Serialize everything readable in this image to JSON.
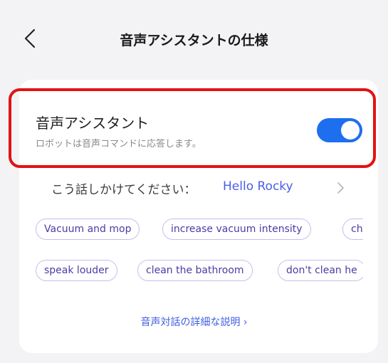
{
  "header": {
    "title": "音声アシスタントの仕様"
  },
  "voice_assistant": {
    "title": "音声アシスタント",
    "subtitle": "ロボットは音声コマンドに応答します。",
    "enabled": true
  },
  "wake_word": {
    "label": "こう話しかけてください：",
    "value": "Hello Rocky"
  },
  "commands": {
    "row1": [
      "Vacuum and mop",
      "increase vacuum intensity",
      "ch"
    ],
    "row2": [
      "speak louder",
      "clean the bathroom",
      "don't clean he"
    ]
  },
  "details_link": "音声対話の詳細な説明 ›",
  "colors": {
    "accent": "#1e6ef0",
    "highlight": "#e31212",
    "chip_border": "#c8bdee",
    "chip_text": "#4d3aa6"
  }
}
